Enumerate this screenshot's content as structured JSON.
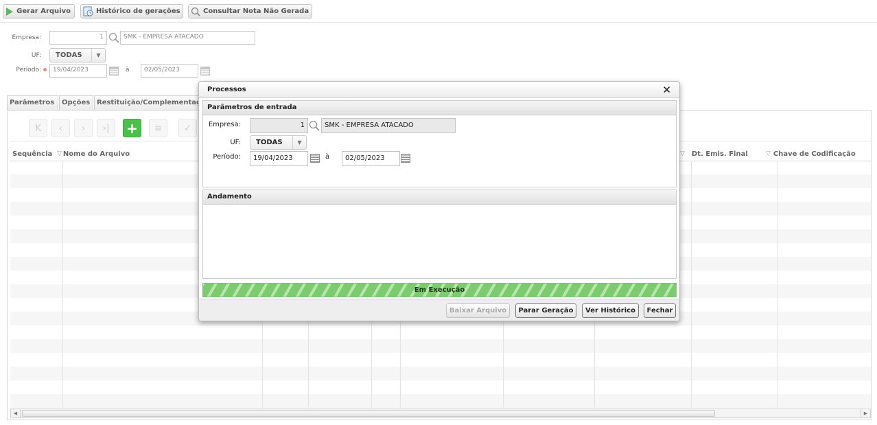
{
  "toolbar": {
    "generate_label": "Gerar Arquivo",
    "history_label": "Histórico de gerações",
    "query_label": "Consultar Nota Não Gerada"
  },
  "form": {
    "empresa_label": "Empresa:",
    "empresa_code": "1",
    "empresa_name": "SMK - EMPRESA ATACADO",
    "uf_label": "UF:",
    "uf_value": "TODAS",
    "periodo_label": "Período:",
    "date_from": "19/04/2023",
    "date_sep": "à",
    "date_to": "02/05/2023"
  },
  "tabs": [
    {
      "label": "Parâmetros"
    },
    {
      "label": "Opções"
    },
    {
      "label": "Restituição/Complementação"
    }
  ],
  "grid": {
    "columns": [
      {
        "label": "Sequência"
      },
      {
        "label": "Nome do Arquivo"
      },
      {
        "label": "Dt. Emis. Final"
      },
      {
        "label": "Chave de Codificação"
      }
    ]
  },
  "dialog": {
    "title": "Processos",
    "input_section_title": "Parâmetros de entrada",
    "empresa_label": "Empresa:",
    "empresa_code": "1",
    "empresa_name": "SMK - EMPRESA ATACADO",
    "uf_label": "UF:",
    "uf_value": "TODAS",
    "periodo_label": "Período:",
    "date_from": "19/04/2023",
    "date_sep": "à",
    "date_to": "02/05/2023",
    "progress_section_title": "Andamento",
    "progress_status": "Em Execução",
    "buttons": {
      "download": "Baixar Arquivo",
      "stop": "Parar Geração",
      "history": "Ver Histórico",
      "close": "Fechar"
    }
  },
  "colors": {
    "progress_green": "#7ccb6e",
    "add_button_green": "#4cc04c"
  }
}
